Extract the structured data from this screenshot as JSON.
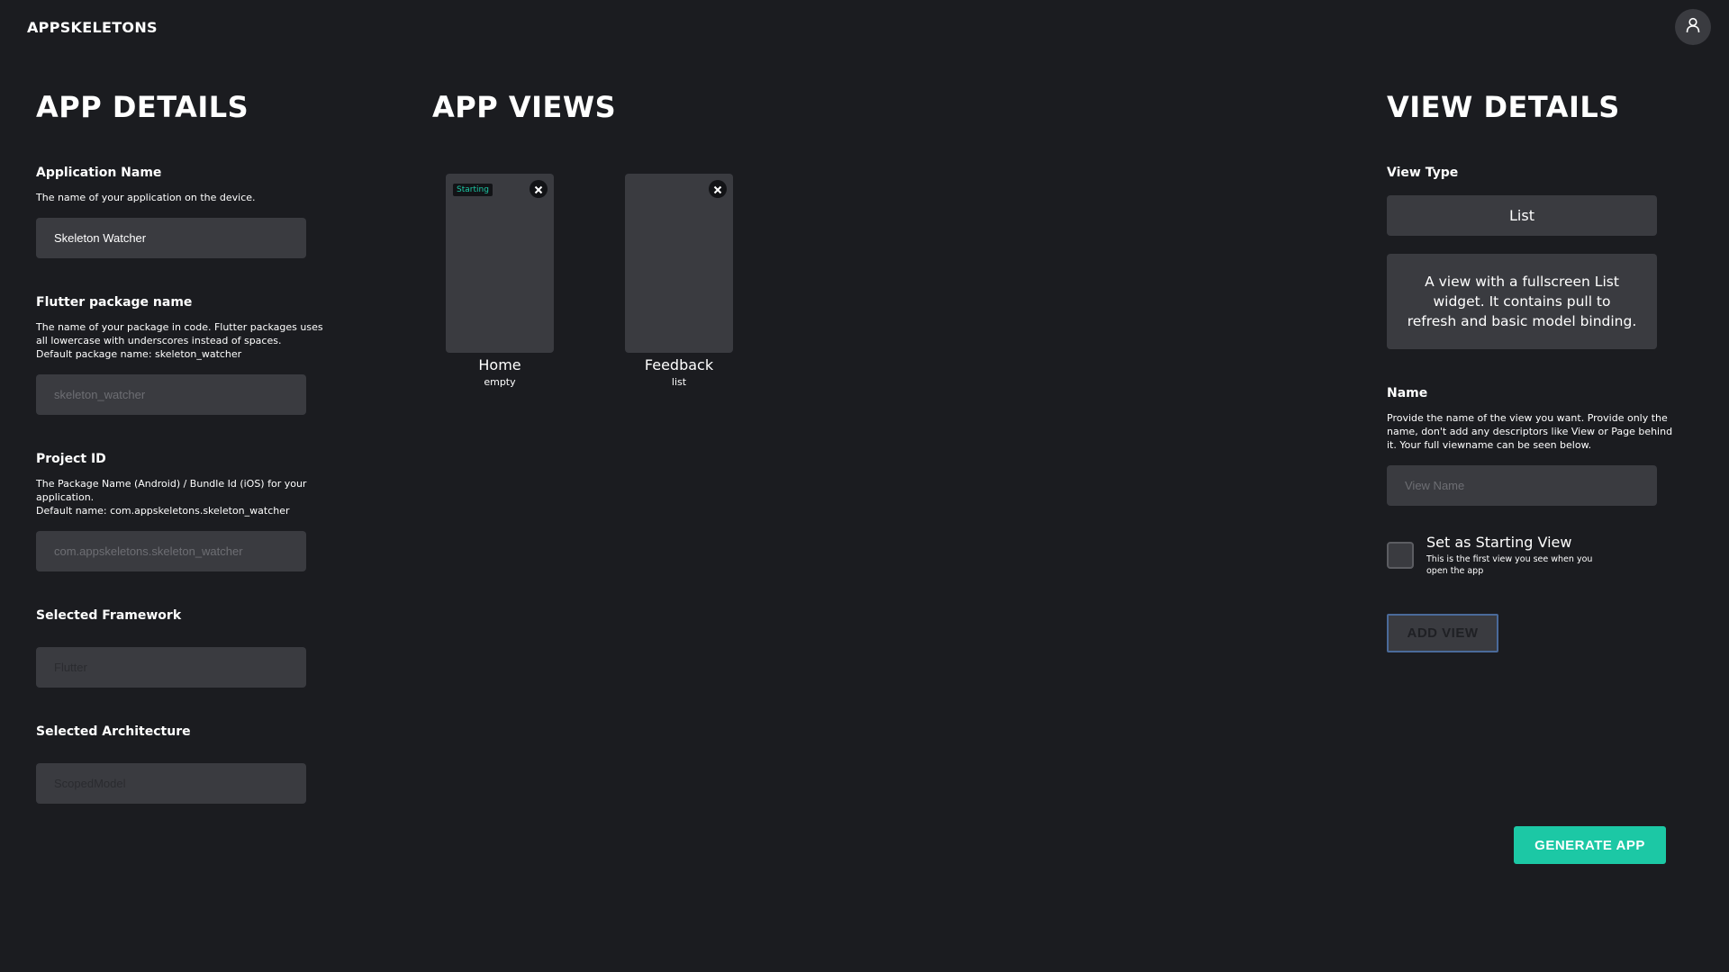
{
  "header": {
    "brand": "APPSKELETONS",
    "user_icon": "user-icon"
  },
  "app_details": {
    "title": "APP DETAILS",
    "fields": [
      {
        "label": "Application Name",
        "help": [
          "The name of your application on the device."
        ],
        "value": "Skeleton Watcher",
        "placeholder": ""
      },
      {
        "label": "Flutter package name",
        "help": [
          "The name of your package in code. Flutter packages uses",
          "all lowercase with underscores instead of spaces.",
          "Default package name: skeleton_watcher"
        ],
        "value": "",
        "placeholder": "skeleton_watcher"
      },
      {
        "label": "Project ID",
        "help": [
          "The Package Name (Android) / Bundle Id (iOS) for your",
          "application.",
          "Default name: com.appskeletons.skeleton_watcher"
        ],
        "value": "",
        "placeholder": "com.appskeletons.skeleton_watcher"
      },
      {
        "label": "Selected Framework",
        "help": [],
        "value": "Flutter",
        "placeholder": ""
      },
      {
        "label": "Selected Architecture",
        "help": [],
        "value": "ScopedModel",
        "placeholder": ""
      }
    ]
  },
  "app_views": {
    "title": "APP VIEWS",
    "views": [
      {
        "name": "Home",
        "type": "empty",
        "badge": "Starting",
        "close_icon": "close-icon"
      },
      {
        "name": "Feedback",
        "type": "list",
        "badge": "",
        "close_icon": "close-icon"
      }
    ]
  },
  "view_details": {
    "title": "VIEW DETAILS",
    "view_type_label": "View Type",
    "view_type_value": "List",
    "view_type_description": "A view with a fullscreen List widget. It contains pull to refresh and basic model binding.",
    "name_label": "Name",
    "name_help": [
      "Provide the name of the view you want. Provide only the",
      "name, don't add any descriptors like View or Page behind",
      "it. Your full viewname can be seen below."
    ],
    "name_value": "",
    "name_placeholder": "View Name",
    "starting_view_label": "Set as Starting View",
    "starting_view_help": "This is the first view you see when you open the app",
    "starting_view_checked": false,
    "add_view_label": "ADD VIEW"
  },
  "actions": {
    "generate_label": "GENERATE APP"
  },
  "colors": {
    "background": "#1b1c20",
    "surface": "#3a3b40",
    "accent": "#1cc8a5",
    "add_view_border": "#4a6a9a"
  }
}
